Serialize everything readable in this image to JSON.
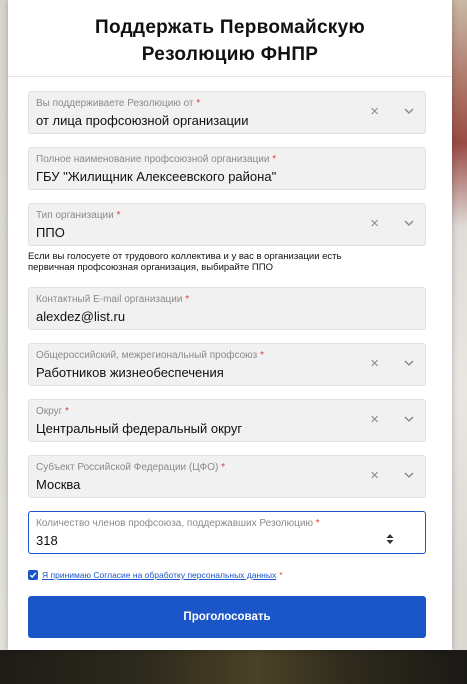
{
  "form": {
    "title_line1": "Поддержать Первомайскую",
    "title_line2": "Резолюцию ФНПР",
    "fields": [
      {
        "label": "Вы поддерживаете Резолюцию от",
        "value": "от лица профсоюзной организации",
        "type": "select"
      },
      {
        "label": "Полное наименование профсоюзной организации",
        "value": "ГБУ \"Жилищник Алексеевского района\"",
        "type": "text"
      },
      {
        "label": "Тип организации",
        "value": "ППО",
        "type": "select"
      },
      {
        "label": "Контактный E-mail организации",
        "value": "alexdez@list.ru",
        "type": "text"
      },
      {
        "label": "Общероссийский, межрегиональный профсоюз",
        "value": "Работников жизнеобеспечения",
        "type": "select"
      },
      {
        "label": "Округ",
        "value": "Центральный федеральный округ",
        "type": "select"
      },
      {
        "label": "Субъект Российской Федерации (ЦФО)",
        "value": "Москва",
        "type": "select"
      },
      {
        "label": "Количество членов профсоюза, поддержавших Резолюцию",
        "value": "318",
        "type": "number"
      }
    ],
    "required_mark": "*",
    "clear_symbol": "×",
    "hint_line1": "Если вы голосуете от трудового коллектива и у вас в организации есть",
    "hint_line2": "первичная профсоюзная организация, выбирайте ППО",
    "consent_text": "Я принимаю Согласие на обработку персональных данных",
    "consent_checked": true,
    "submit_label": "Проголосовать"
  },
  "colors": {
    "accent": "#1a56c8",
    "required": "#e03a3a",
    "field_bg": "#f1f1f1"
  },
  "icons": {
    "clear": "close-icon",
    "dropdown": "chevron-down-icon",
    "stepper": "number-stepper-icon",
    "checkbox": "checkmark-icon"
  }
}
